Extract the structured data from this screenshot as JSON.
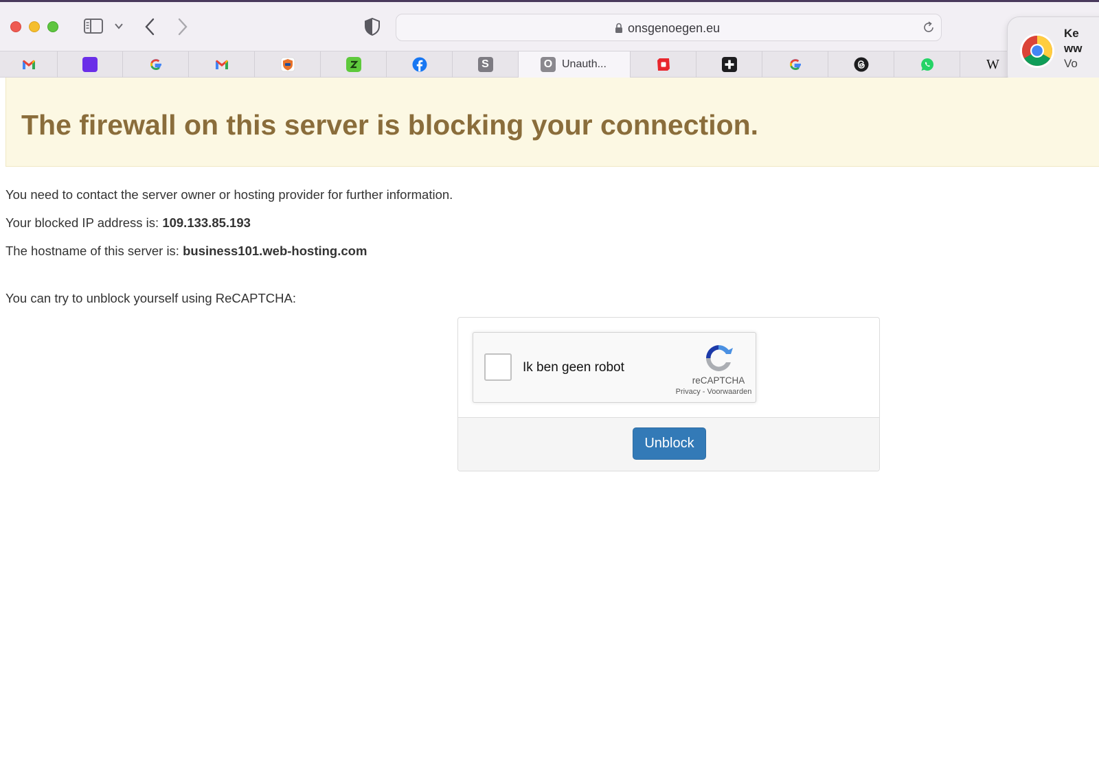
{
  "browser": {
    "url": "onsgenoegen.eu",
    "tabs": [
      {
        "name": "gmail",
        "icon": "gmail-icon"
      },
      {
        "name": "purple",
        "icon": "purple-square-icon"
      },
      {
        "name": "google",
        "icon": "google-icon"
      },
      {
        "name": "gmail",
        "icon": "gmail-icon"
      },
      {
        "name": "shield-car",
        "icon": "shield-car-icon"
      },
      {
        "name": "green-app",
        "icon": "green-app-icon"
      },
      {
        "name": "facebook",
        "icon": "facebook-icon"
      },
      {
        "name": "s-app",
        "icon": "s-app-icon",
        "letter": "S"
      },
      {
        "name": "active",
        "icon": "o-app-icon",
        "letter": "O",
        "title": "Unauth..."
      },
      {
        "name": "red-app",
        "icon": "red-app-icon"
      },
      {
        "name": "plus-app",
        "icon": "plus-app-icon"
      },
      {
        "name": "google",
        "icon": "google-icon"
      },
      {
        "name": "threads",
        "icon": "threads-icon"
      },
      {
        "name": "whatsapp",
        "icon": "whatsapp-icon"
      },
      {
        "name": "wikipedia",
        "icon": "wikipedia-icon",
        "letter": "W"
      }
    ]
  },
  "notification": {
    "line1": "Ke",
    "line2": "ww",
    "line3": "Vo"
  },
  "page": {
    "heading": "The firewall on this server is blocking your connection.",
    "contact_text": "You need to contact the server owner or hosting provider for further information.",
    "ip_label": "Your blocked IP address is: ",
    "ip_value": "109.133.85.193",
    "host_label": "The hostname of this server is: ",
    "host_value": "business101.web-hosting.com",
    "recaptcha_hint": "You can try to unblock yourself using ReCAPTCHA:"
  },
  "recaptcha": {
    "label": "Ik ben geen robot",
    "brand": "reCAPTCHA",
    "links": "Privacy - Voorwaarden"
  },
  "unblock_label": "Unblock",
  "colors": {
    "banner_bg": "#fcf8e3",
    "banner_text": "#8a6d3b",
    "button": "#337ab7"
  }
}
